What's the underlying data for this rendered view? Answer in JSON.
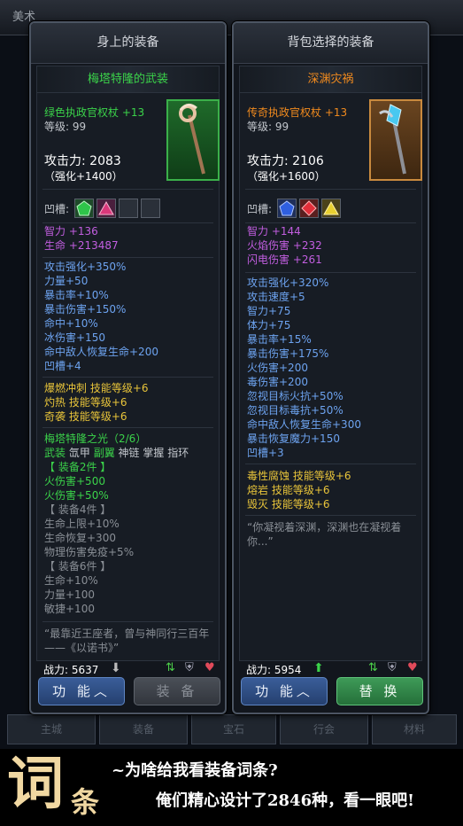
{
  "background": {
    "top_title": "美术",
    "tabs": [
      "主城",
      "装备",
      "宝石",
      "行会",
      "材料"
    ]
  },
  "left": {
    "header": "身上的装备",
    "item_name": "梅塔特隆的武装",
    "item_type": "绿色执政官权杖 +13",
    "level": "等级: 99",
    "attack": "攻击力:  2083",
    "enhance": "（强化+1400）",
    "sockets_label": "凹槽:",
    "base_stats": [
      "智力 +136",
      "生命 +213487"
    ],
    "extra_stats": [
      "攻击强化+350%",
      "力量+50",
      "暴击率+10%",
      "暴击伤害+150%",
      "命中+10%",
      "冰伤害+150",
      "命中敌人恢复生命+200",
      "凹槽+4"
    ],
    "skill_stats": [
      "爆燃冲刺 技能等级+6",
      "灼热 技能等级+6",
      "奇袭 技能等级+6"
    ],
    "set_title": "梅塔特隆之光（2/6）",
    "set_parts": [
      "武装",
      "氙甲",
      "副翼",
      "神链",
      "掌握",
      "指环"
    ],
    "set2_label": "【 装备2件 】",
    "set2_stats": [
      "火伤害+500",
      "火伤害+50%"
    ],
    "set4_label": "【 装备4件 】",
    "set4_stats": [
      "生命上限+10%",
      "生命恢复+300",
      "物理伤害免疫+5%"
    ],
    "set6_label": "【 装备6件 】",
    "set6_stats": [
      "生命+10%",
      "力量+100",
      "敏捷+100"
    ],
    "quote": "“最靠近王座者，曾与神同行三百年——《以诺书》”",
    "power": "战力: 5637",
    "btn_function": "功 能",
    "btn_equip": "装 备"
  },
  "right": {
    "header": "背包选择的装备",
    "item_name": "深渊灾祸",
    "item_type": "传奇执政官权杖 +13",
    "level": "等级: 99",
    "attack": "攻击力:  2106",
    "enhance": "（强化+1600）",
    "sockets_label": "凹槽:",
    "base_stats": [
      "智力 +144",
      "火焰伤害 +232",
      "闪电伤害 +261"
    ],
    "extra_stats": [
      "攻击强化+320%",
      "攻击速度+5",
      "智力+75",
      "体力+75",
      "暴击率+15%",
      "暴击伤害+175%",
      "火伤害+200",
      "毒伤害+200",
      "忽视目标火抗+50%",
      "忽视目标毒抗+50%",
      "命中敌人恢复生命+300",
      "暴击恢复魔力+150",
      "凹槽+3"
    ],
    "skill_stats": [
      "毒性腐蚀 技能等级+6",
      "熔岩 技能等级+6",
      "毁灭 技能等级+6"
    ],
    "quote": "“你凝视着深渊，深渊也在凝视着你...”",
    "power": "战力: 5954",
    "btn_function": "功 能",
    "btn_swap": "替 换"
  },
  "banner": {
    "big1": "词",
    "big2": "条",
    "line1": "~为啥给我看装备词条?",
    "line2": "俺们精心设计了2846种，看一眼吧!"
  },
  "colors": {
    "green_item": "#3bd34a",
    "legend_item": "#f08a1e",
    "purple": "#c25ee0",
    "blue_stat": "#6da3f0",
    "gold": "#e8c43a"
  }
}
